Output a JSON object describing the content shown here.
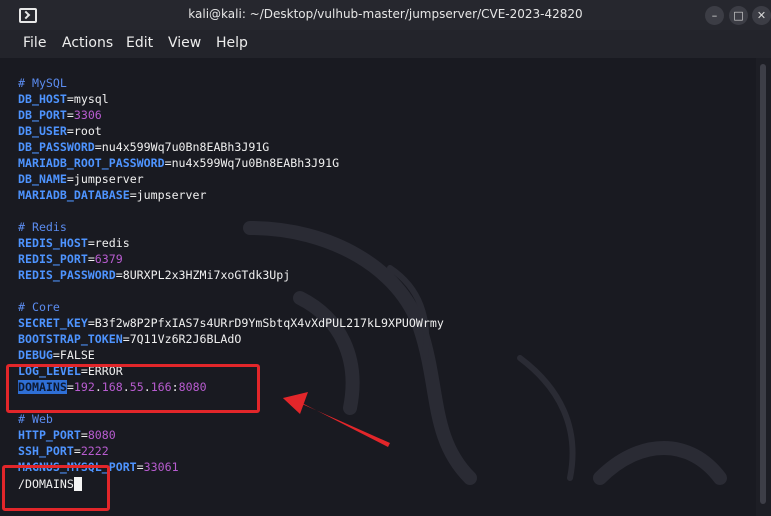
{
  "window": {
    "title": "kali@kali: ~/Desktop/vulhub-master/jumpserver/CVE-2023-42820",
    "minimize_glyph": "–",
    "maximize_glyph": "□",
    "close_glyph": "✕"
  },
  "menu": [
    "File",
    "Actions",
    "Edit",
    "View",
    "Help"
  ],
  "terminal": {
    "mysql_comment": "# MySQL",
    "db_host_key": "DB_HOST",
    "db_host_val": "mysql",
    "db_port_key": "DB_PORT",
    "db_port_val": "3306",
    "db_user_key": "DB_USER",
    "db_user_val": "root",
    "db_password_key": "DB_PASSWORD",
    "db_password_val": "nu4x599Wq7u0Bn8EABh3J91G",
    "mariadb_root_key": "MARIADB_ROOT_PASSWORD",
    "mariadb_root_val": "nu4x599Wq7u0Bn8EABh3J91G",
    "db_name_key": "DB_NAME",
    "db_name_val": "jumpserver",
    "mariadb_db_key": "MARIADB_DATABASE",
    "mariadb_db_val": "jumpserver",
    "redis_comment": "# Redis",
    "redis_host_key": "REDIS_HOST",
    "redis_host_val": "redis",
    "redis_port_key": "REDIS_PORT",
    "redis_port_val": "6379",
    "redis_password_key": "REDIS_PASSWORD",
    "redis_password_val": "8URXPL2x3HZMi7xoGTdk3Upj",
    "core_comment": "# Core",
    "secret_key_key": "SECRET_KEY",
    "secret_key_val": "B3f2w8P2PfxIAS7s4URrD9YmSbtqX4vXdPUL217kL9XPUOWrmy",
    "bootstrap_key": "BOOTSTRAP_TOKEN",
    "bootstrap_val": "7Q11Vz6R2J6BLAdO",
    "debug_key": "DEBUG",
    "debug_val": "FALSE",
    "log_level_key": "LOG_LEVEL",
    "log_level_val": "ERROR",
    "domains_key": "DOMAINS",
    "domains_ip1": "192",
    "domains_ip2": "168",
    "domains_ip3": "55",
    "domains_ip4": "166",
    "domains_port": "8080",
    "web_comment": "# Web",
    "http_port_key": "HTTP_PORT",
    "http_port_val": "8080",
    "ssh_port_key": "SSH_PORT",
    "ssh_port_val": "2222",
    "magnus_key": "MAGNUS_MYSQL_PORT",
    "magnus_val": "33061",
    "search_prompt": "/DOMAINS"
  },
  "colors": {
    "key": "#4e94ff",
    "comment": "#5b8cf0",
    "number": "#b85cd0",
    "annotation": "#e2262a"
  },
  "icons": [
    "terminal-icon",
    "minimize-icon",
    "maximize-icon",
    "close-icon",
    "kali-dragon-watermark",
    "annotation-arrow"
  ]
}
